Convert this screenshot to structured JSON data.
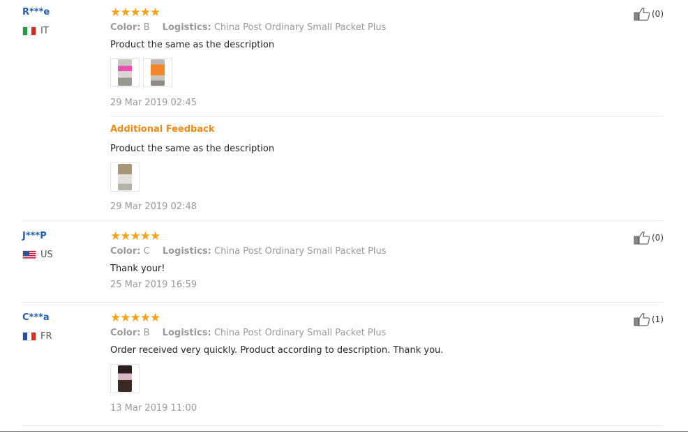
{
  "reviews": [
    {
      "user": "R***e",
      "country": "IT",
      "stars": "★★★★★",
      "color_label": "Color:",
      "color_value": "B",
      "logistics_label": "Logistics:",
      "logistics_value": "China Post Ordinary Small Packet Plus",
      "text": "Product the same as the description",
      "date": "29 Mar 2019 02:45",
      "likes": "(0)",
      "additional_feedback": {
        "title": "Additional Feedback",
        "text": "Product the same as the description",
        "date": "29 Mar 2019 02:48"
      }
    },
    {
      "user": "J***P",
      "country": "US",
      "stars": "★★★★★",
      "color_label": "Color:",
      "color_value": "C",
      "logistics_label": "Logistics:",
      "logistics_value": "China Post Ordinary Small Packet Plus",
      "text": "Thank your!",
      "date": "25 Mar 2019 16:59",
      "likes": "(0)"
    },
    {
      "user": "C***a",
      "country": "FR",
      "stars": "★★★★★",
      "color_label": "Color:",
      "color_value": "B",
      "logistics_label": "Logistics:",
      "logistics_value": "China Post Ordinary Small Packet Plus",
      "text": "Order received very quickly. Product according to description. Thank you.",
      "date": "13 Mar 2019 11:00",
      "likes": "(1)"
    }
  ],
  "colors": {
    "user_name": "#1f5fb4",
    "star": "#f5a318",
    "additional_feedback": "#f08a12",
    "meta_gray": "#999999"
  },
  "icons": [
    "thumbs-up-icon",
    "flag-it-icon",
    "flag-us-icon",
    "flag-fr-icon"
  ]
}
